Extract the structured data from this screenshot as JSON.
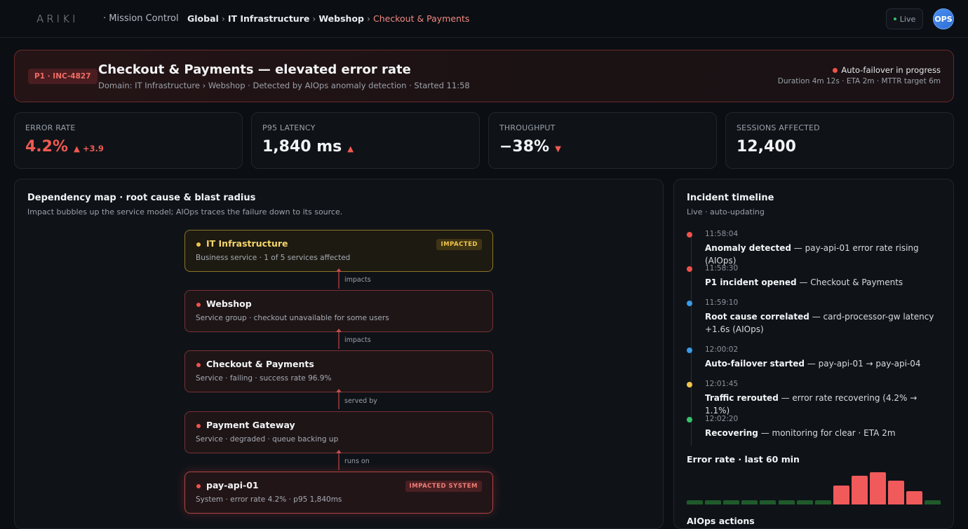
{
  "topbar": {
    "logo": "ARIKI",
    "app_name": "· Mission Control",
    "breadcrumbs": [
      "Global",
      "IT Infrastructure",
      "Webshop",
      "Checkout & Payments"
    ],
    "breadcrumb_sep": "›",
    "live_label": "Live",
    "avatar_initials": "OPS"
  },
  "incident": {
    "badge": "P1 · INC-4827",
    "title": "Checkout & Payments — elevated error rate",
    "subtitle": "Domain: IT Infrastructure › Webshop · Detected by AIOps anomaly detection · Started 11:58",
    "status": "Auto-failover in progress",
    "meta": "Duration 4m 12s · ETA 2m · MTTR target 6m"
  },
  "kpis": [
    {
      "label": "ERROR RATE",
      "value": "4.2%",
      "delta": "▲ +3.9"
    },
    {
      "label": "P95 LATENCY",
      "value": "1,840 ms",
      "delta": "▲"
    },
    {
      "label": "THROUGHPUT",
      "value": "−38%",
      "delta": "▼"
    },
    {
      "label": "SESSIONS AFFECTED",
      "value": "12,400",
      "delta": ""
    }
  ],
  "dependency_map": {
    "title": "Dependency map · root cause & blast radius",
    "subtitle": "Impact bubbles up the service model; AIOps traces the failure down to its source.",
    "nodes": [
      {
        "name": "IT Infrastructure",
        "desc": "Business service · 1 of 5 services affected",
        "tag": "IMPACTED",
        "state": "warn"
      },
      {
        "name": "Webshop",
        "desc": "Service group · checkout unavailable for some users",
        "tag": "",
        "state": "bad"
      },
      {
        "name": "Checkout & Payments",
        "desc": "Service · failing · success rate 96.9%",
        "tag": "",
        "state": "bad"
      },
      {
        "name": "Payment Gateway",
        "desc": "Service · degraded · queue backing up",
        "tag": "",
        "state": "bad"
      },
      {
        "name": "pay-api-01",
        "desc": "System · error rate 4.2% · p95 1,840ms",
        "tag": "IMPACTED SYSTEM",
        "state": "root"
      }
    ],
    "edges": [
      "impacts",
      "impacts",
      "served by",
      "runs on"
    ]
  },
  "timeline": {
    "title": "Incident timeline",
    "subtitle": "Live · auto-updating",
    "events": [
      {
        "time": "11:58:04",
        "bold": "Anomaly detected",
        "text": " — pay-api-01 error rate rising (AIOps)",
        "color": "#f0524b"
      },
      {
        "time": "11:58:30",
        "bold": "P1 incident opened",
        "text": " — Checkout & Payments",
        "color": "#f0524b"
      },
      {
        "time": "11:59:10",
        "bold": "Root cause correlated",
        "text": " — card-processor-gw latency +1.6s (AIOps)",
        "color": "#3a9be6"
      },
      {
        "time": "12:00:02",
        "bold": "Auto-failover started",
        "text": " — pay-api-01 → pay-api-04",
        "color": "#3a9be6"
      },
      {
        "time": "12:01:45",
        "bold": "Traffic rerouted",
        "text": " — error rate recovering (4.2% → 1.1%)",
        "color": "#f1c44a"
      },
      {
        "time": "12:02:20",
        "bold": "Recovering",
        "text": " — monitoring for clear · ETA 2m",
        "color": "#36c46b"
      }
    ],
    "spark_title": "Error rate · last 60 min",
    "spark_values": [
      0.3,
      0.3,
      0.3,
      0.3,
      0.3,
      0.3,
      0.3,
      0.3,
      2.6,
      4.0,
      4.5,
      3.3,
      1.9,
      0.4
    ],
    "next_section": "AIOps actions"
  }
}
